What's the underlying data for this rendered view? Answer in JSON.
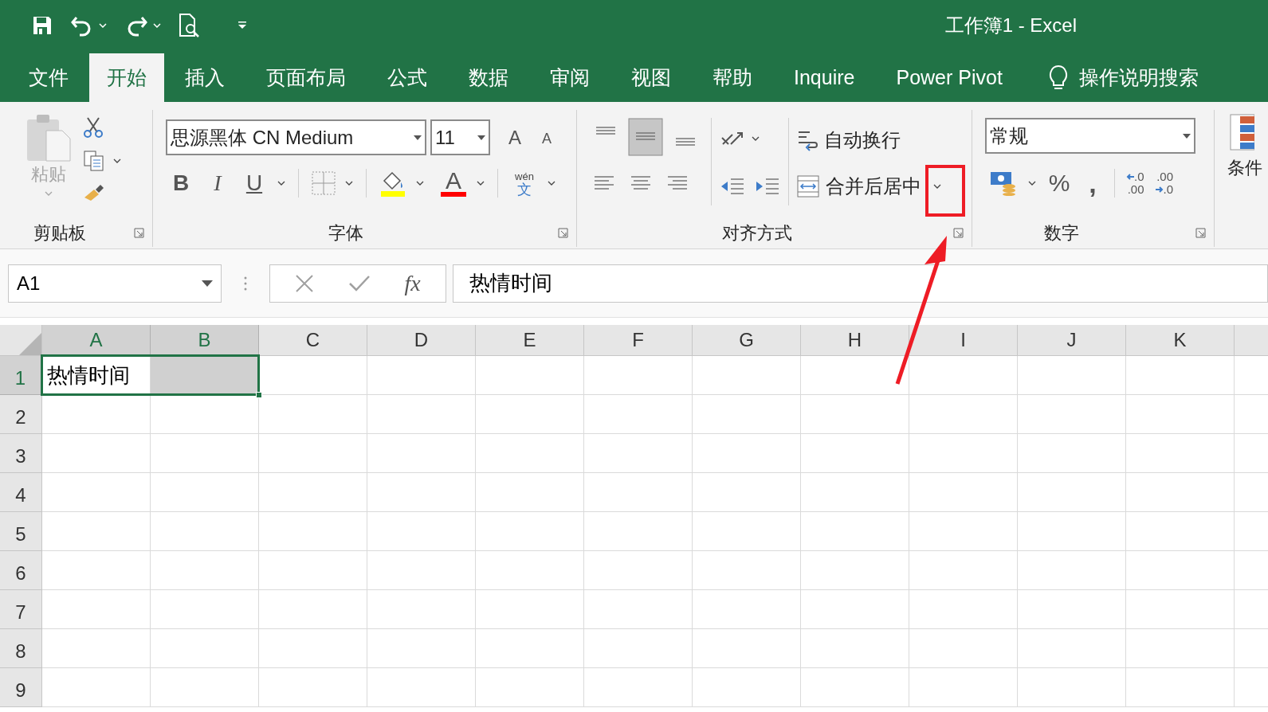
{
  "window": {
    "title": "工作簿1 - Excel"
  },
  "tabs": [
    {
      "label": "文件",
      "selected": false
    },
    {
      "label": "开始",
      "selected": true
    },
    {
      "label": "插入",
      "selected": false
    },
    {
      "label": "页面布局",
      "selected": false
    },
    {
      "label": "公式",
      "selected": false
    },
    {
      "label": "数据",
      "selected": false
    },
    {
      "label": "审阅",
      "selected": false
    },
    {
      "label": "视图",
      "selected": false
    },
    {
      "label": "帮助",
      "selected": false
    },
    {
      "label": "Inquire",
      "selected": false
    },
    {
      "label": "Power Pivot",
      "selected": false
    }
  ],
  "tell_me": {
    "label": "操作说明搜索"
  },
  "ribbon": {
    "clipboard": {
      "label": "剪贴板",
      "paste": "粘贴"
    },
    "font": {
      "label": "字体",
      "font_name": "思源黑体 CN Medium",
      "font_size": "11",
      "grow": "A",
      "shrink": "A",
      "bold": "B",
      "italic": "I",
      "underline": "U",
      "font_color": "A",
      "phonetic": "wén",
      "phonetic_char": "文"
    },
    "alignment": {
      "label": "对齐方式",
      "vertical_align": [
        {
          "selected": false
        },
        {
          "selected": true
        },
        {
          "selected": false
        }
      ],
      "wrap_text": "自动换行",
      "merge": "合并后居中"
    },
    "number": {
      "label": "数字",
      "format": "常规",
      "percent": "%",
      "comma": ",",
      "increase_decimal": [
        ".0",
        ".00"
      ],
      "decrease_decimal": [
        ".00",
        ".0"
      ]
    },
    "styles": {
      "conditional": "条件"
    }
  },
  "formula_bar": {
    "name_box": "A1",
    "fx": "fx",
    "value": "热情时间"
  },
  "sheet": {
    "columns": [
      {
        "label": "A",
        "selected": true
      },
      {
        "label": "B",
        "selected": true
      },
      {
        "label": "C",
        "selected": false
      },
      {
        "label": "D",
        "selected": false
      },
      {
        "label": "E",
        "selected": false
      },
      {
        "label": "F",
        "selected": false
      },
      {
        "label": "G",
        "selected": false
      },
      {
        "label": "H",
        "selected": false
      },
      {
        "label": "I",
        "selected": false
      },
      {
        "label": "J",
        "selected": false
      },
      {
        "label": "K",
        "selected": false
      }
    ],
    "rows": [
      {
        "label": "1",
        "selected": true,
        "cells": [
          "热情时间"
        ]
      },
      {
        "label": "2",
        "selected": false
      },
      {
        "label": "3",
        "selected": false
      },
      {
        "label": "4",
        "selected": false
      },
      {
        "label": "5",
        "selected": false
      },
      {
        "label": "6",
        "selected": false
      },
      {
        "label": "7",
        "selected": false
      },
      {
        "label": "8",
        "selected": false
      },
      {
        "label": "9",
        "selected": false
      }
    ]
  }
}
